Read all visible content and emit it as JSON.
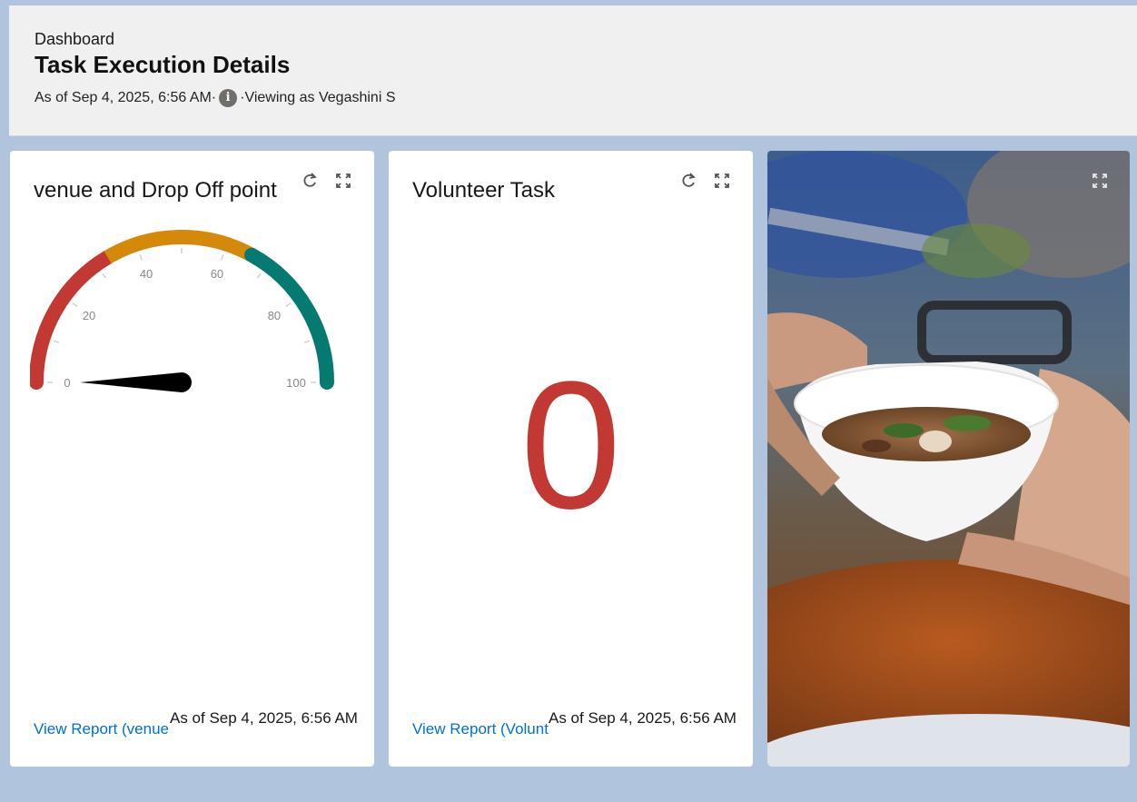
{
  "header": {
    "breadcrumb": "Dashboard",
    "title": "Task Execution Details",
    "as_of": "As of Sep 4, 2025, 6:56 AM·",
    "viewing_as": "·Viewing as Vegashini S",
    "info_icon_glyph": "i"
  },
  "widgets": [
    {
      "title": "venue and Drop Off point",
      "type": "gauge",
      "gauge": {
        "value": 0,
        "min": 0,
        "max": 100,
        "ticks": [
          "0",
          "20",
          "40",
          "60",
          "80",
          "100"
        ],
        "bands": [
          {
            "from": 0,
            "to": 33,
            "color": "#c23934"
          },
          {
            "from": 33,
            "to": 66,
            "color": "#d4890a"
          },
          {
            "from": 66,
            "to": 100,
            "color": "#057a70"
          }
        ]
      },
      "view_report": "View Report (venue and Drop Off point)",
      "as_of": "As of Sep 4, 2025, 6:56 AM",
      "icons": [
        "refresh-icon",
        "expand-icon"
      ]
    },
    {
      "title": "Volunteer Task",
      "type": "metric",
      "value": "0",
      "value_color": "#c23934",
      "view_report": "View Report (Volunteer Task)",
      "as_of": "As of Sep 4, 2025, 6:56 AM",
      "icons": [
        "refresh-icon",
        "expand-icon"
      ]
    },
    {
      "type": "image",
      "icons": [
        "expand-icon"
      ]
    }
  ]
}
